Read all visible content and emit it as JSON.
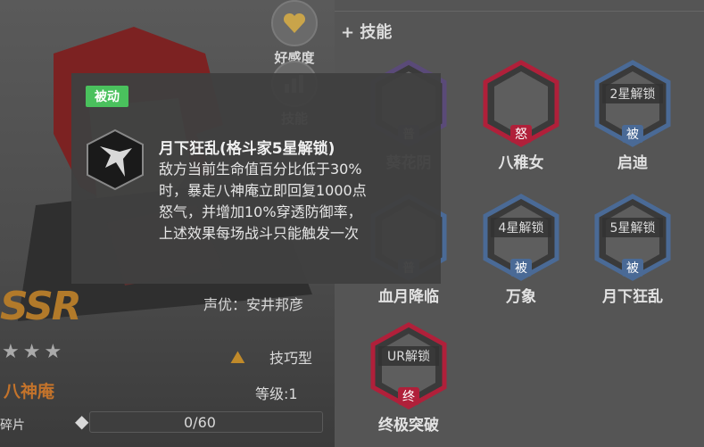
{
  "side_buttons": {
    "favor_label": "好感度",
    "favor_icon": "heart-icon",
    "stats_icon": "bar-chart-icon",
    "stats_label": "技能"
  },
  "skills_section": {
    "title": "+ 技能"
  },
  "skills": [
    {
      "name": "葵花阴",
      "badge": "普",
      "lock": "",
      "color": "#5a4a78"
    },
    {
      "name": "八稚女",
      "badge": "怒",
      "lock": "",
      "color": "#b0203a"
    },
    {
      "name": "启迪",
      "badge": "被",
      "lock": "2星解锁",
      "color": "#4a6a96"
    },
    {
      "name": "血月降临",
      "badge": "普",
      "lock": "",
      "color": "#4a6a96"
    },
    {
      "name": "万象",
      "badge": "被",
      "lock": "4星解锁",
      "color": "#4a6a96"
    },
    {
      "name": "月下狂乱",
      "badge": "被",
      "lock": "5星解锁",
      "color": "#4a6a96"
    },
    {
      "name": "终极突破",
      "badge": "终",
      "lock": "UR解锁",
      "color": "#b0203a"
    }
  ],
  "tooltip": {
    "badge": "被动",
    "title": "月下狂乱(格斗家5星解锁)",
    "lines": [
      "敌方当前生命值百分比低于30%",
      "时，暴走八神庵立即回复1000点",
      "怒气，并增加10%穿透防御率，",
      "上述效果每场战斗只能触发一次"
    ]
  },
  "character": {
    "voice_actor": "声优：安井邦彦",
    "rarity": "SSR",
    "stars": "★★★",
    "name": "八神庵",
    "type_icon": "mountain-icon",
    "type": "技巧型",
    "level": "等级:1",
    "shard_label": "碎片",
    "shard_count": "0/60",
    "shard_progress": 0
  }
}
